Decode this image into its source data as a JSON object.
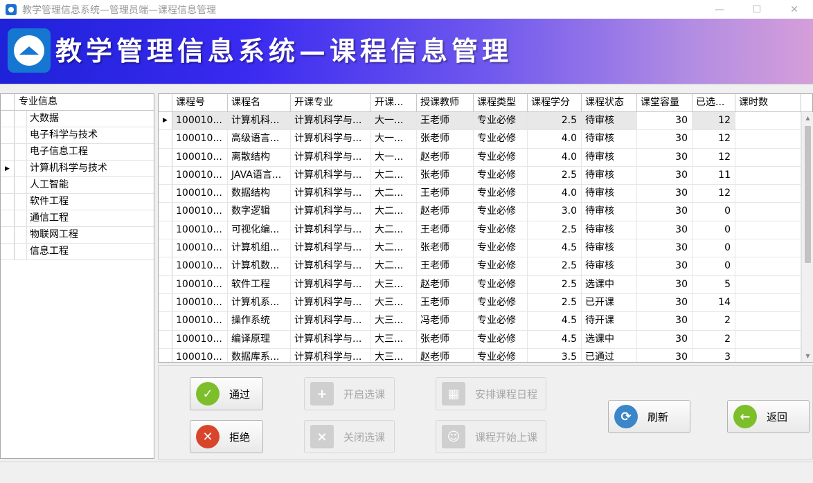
{
  "window": {
    "title": "教学管理信息系统—管理员端—课程信息管理",
    "controls": {
      "minimize": "—",
      "maximize": "☐",
      "close": "✕"
    }
  },
  "banner": {
    "title": "教学管理信息系统—课程信息管理",
    "logo_icon": "graduation-cap-icon"
  },
  "major_grid": {
    "header": "专业信息",
    "selected_index": 3,
    "items": [
      "大数据",
      "电子科学与技术",
      "电子信息工程",
      "计算机科学与技术",
      "人工智能",
      "软件工程",
      "通信工程",
      "物联网工程",
      "信息工程"
    ]
  },
  "course_grid": {
    "headers": [
      "课程号",
      "课程名",
      "开课专业",
      "开课...",
      "授课教师",
      "课程类型",
      "课程学分",
      "课程状态",
      "课堂容量",
      "已选...",
      "课时数"
    ],
    "rows": [
      [
        "100010...",
        "计算机科...",
        "计算机科学与...",
        "大一...",
        "王老师",
        "专业必修",
        "2.5",
        "待审核",
        "30",
        "12",
        ""
      ],
      [
        "100010...",
        "高级语言...",
        "计算机科学与...",
        "大一...",
        "张老师",
        "专业必修",
        "4.0",
        "待审核",
        "30",
        "12",
        ""
      ],
      [
        "100010...",
        "离散结构",
        "计算机科学与...",
        "大一...",
        "赵老师",
        "专业必修",
        "4.0",
        "待审核",
        "30",
        "12",
        ""
      ],
      [
        "100010...",
        "JAVA语言...",
        "计算机科学与...",
        "大二...",
        "张老师",
        "专业必修",
        "2.5",
        "待审核",
        "30",
        "11",
        ""
      ],
      [
        "100010...",
        "数据结构",
        "计算机科学与...",
        "大二...",
        "王老师",
        "专业必修",
        "4.0",
        "待审核",
        "30",
        "12",
        ""
      ],
      [
        "100010...",
        "数字逻辑",
        "计算机科学与...",
        "大二...",
        "赵老师",
        "专业必修",
        "3.0",
        "待审核",
        "30",
        "0",
        ""
      ],
      [
        "100010...",
        "可视化编...",
        "计算机科学与...",
        "大二...",
        "王老师",
        "专业必修",
        "2.5",
        "待审核",
        "30",
        "0",
        ""
      ],
      [
        "100010...",
        "计算机组...",
        "计算机科学与...",
        "大二...",
        "张老师",
        "专业必修",
        "4.5",
        "待审核",
        "30",
        "0",
        ""
      ],
      [
        "100010...",
        "计算机数...",
        "计算机科学与...",
        "大二...",
        "王老师",
        "专业必修",
        "2.5",
        "待审核",
        "30",
        "0",
        ""
      ],
      [
        "100010...",
        "软件工程",
        "计算机科学与...",
        "大三...",
        "赵老师",
        "专业必修",
        "2.5",
        "选课中",
        "30",
        "5",
        ""
      ],
      [
        "100010...",
        "计算机系...",
        "计算机科学与...",
        "大三...",
        "王老师",
        "专业必修",
        "2.5",
        "已开课",
        "30",
        "14",
        ""
      ],
      [
        "100010...",
        "操作系统",
        "计算机科学与...",
        "大三...",
        "冯老师",
        "专业必修",
        "4.5",
        "待开课",
        "30",
        "2",
        ""
      ],
      [
        "100010...",
        "编译原理",
        "计算机科学与...",
        "大三...",
        "张老师",
        "专业必修",
        "4.5",
        "选课中",
        "30",
        "2",
        ""
      ],
      [
        "100010...",
        "数据库系...",
        "计算机科学与...",
        "大三...",
        "赵老师",
        "专业必修",
        "3.5",
        "已通过",
        "30",
        "3",
        ""
      ]
    ]
  },
  "buttons": {
    "approve": "通过",
    "reject": "拒绝",
    "open_selection": "开启选课",
    "close_selection": "关闭选课",
    "schedule": "安排课程日程",
    "start_class": "课程开始上课",
    "refresh": "刷新",
    "back": "返回"
  },
  "colors": {
    "approve": "#7cbf2a",
    "reject": "#d9452b",
    "back": "#7cbf2a",
    "refresh": "#3a86c8"
  }
}
